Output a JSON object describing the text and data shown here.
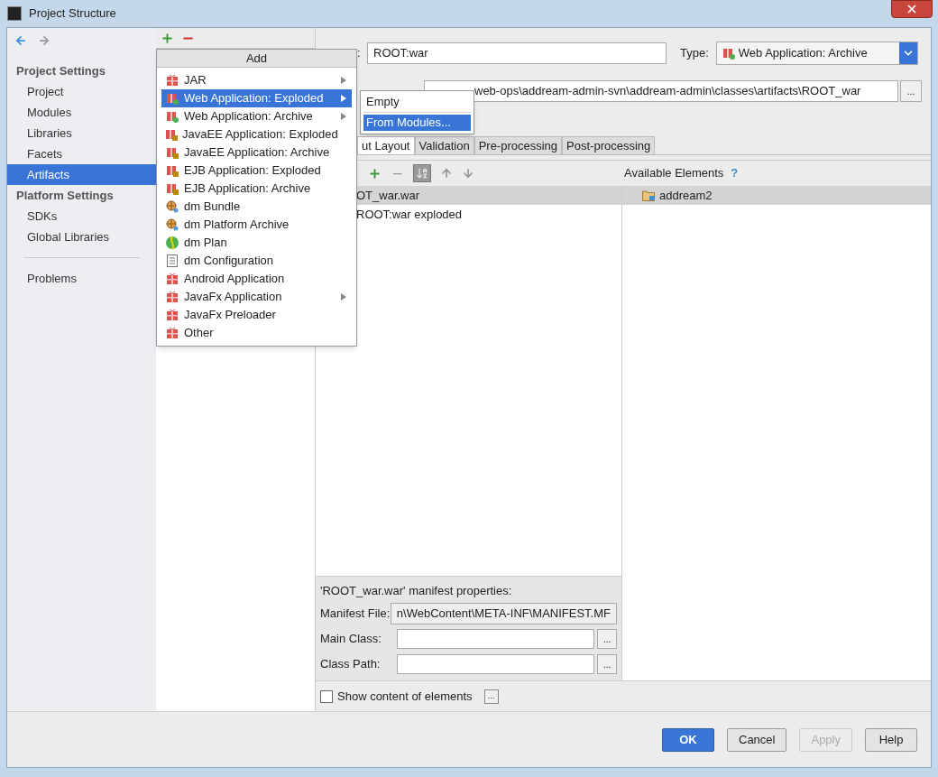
{
  "window": {
    "title": "Project Structure"
  },
  "nav": {
    "sections": [
      {
        "title": "Project Settings",
        "items": [
          {
            "label": "Project",
            "selected": false
          },
          {
            "label": "Modules",
            "selected": false
          },
          {
            "label": "Libraries",
            "selected": false
          },
          {
            "label": "Facets",
            "selected": false
          },
          {
            "label": "Artifacts",
            "selected": true
          }
        ]
      },
      {
        "title": "Platform Settings",
        "items": [
          {
            "label": "SDKs",
            "selected": false
          },
          {
            "label": "Global Libraries",
            "selected": false
          }
        ]
      }
    ],
    "extra": [
      {
        "label": "Problems",
        "selected": false
      }
    ]
  },
  "add_menu": {
    "title": "Add",
    "items": [
      {
        "label": "JAR",
        "kind": "artifact",
        "submenu": true,
        "selected": false
      },
      {
        "label": "Web Application: Exploded",
        "kind": "web",
        "submenu": true,
        "selected": true
      },
      {
        "label": "Web Application: Archive",
        "kind": "web",
        "submenu": true,
        "selected": false
      },
      {
        "label": "JavaEE Application: Exploded",
        "kind": "javaee",
        "submenu": false,
        "selected": false
      },
      {
        "label": "JavaEE Application: Archive",
        "kind": "javaee",
        "submenu": false,
        "selected": false
      },
      {
        "label": "EJB Application: Exploded",
        "kind": "javaee",
        "submenu": false,
        "selected": false
      },
      {
        "label": "EJB Application: Archive",
        "kind": "javaee",
        "submenu": false,
        "selected": false
      },
      {
        "label": "dm Bundle",
        "kind": "bundle",
        "submenu": false,
        "selected": false
      },
      {
        "label": "dm Platform Archive",
        "kind": "bundle",
        "submenu": false,
        "selected": false
      },
      {
        "label": "dm Plan",
        "kind": "plan",
        "submenu": false,
        "selected": false
      },
      {
        "label": "dm Configuration",
        "kind": "config",
        "submenu": false,
        "selected": false
      },
      {
        "label": "Android Application",
        "kind": "artifact",
        "submenu": false,
        "selected": false
      },
      {
        "label": "JavaFx Application",
        "kind": "artifact",
        "submenu": true,
        "selected": false
      },
      {
        "label": "JavaFx Preloader",
        "kind": "artifact",
        "submenu": false,
        "selected": false
      },
      {
        "label": "Other",
        "kind": "artifact",
        "submenu": false,
        "selected": false
      }
    ]
  },
  "submenu": {
    "items": [
      {
        "label": "Empty",
        "selected": false
      },
      {
        "label": "From Modules...",
        "selected": true
      }
    ]
  },
  "artifact": {
    "name_label": ":",
    "name_value": "ROOT:war",
    "type_label": "Type:",
    "type_value": "Web Application: Archive",
    "output_path": "web-ops\\addream-admin-svn\\addream-admin\\classes\\artifacts\\ROOT_war",
    "tabs": [
      {
        "label": "ut Layout",
        "selected": true
      },
      {
        "label": "Validation",
        "selected": false
      },
      {
        "label": "Pre-processing",
        "selected": false
      },
      {
        "label": "Post-processing",
        "selected": false
      }
    ],
    "tree": [
      {
        "label": "OT_war.war",
        "selected": true
      },
      {
        "label": "ROOT:war exploded",
        "selected": false
      }
    ],
    "available_title": "Available Elements",
    "help": "?",
    "available": [
      {
        "label": "addream2",
        "selected": true
      }
    ],
    "manifest": {
      "title": "'ROOT_war.war' manifest properties:",
      "fields": [
        {
          "label": "Manifest File:",
          "value": "n\\WebContent\\META-INF\\MANIFEST.MF",
          "kind": "readonly"
        },
        {
          "label": "Main Class:",
          "kind": "browse"
        },
        {
          "label": "Class Path:",
          "kind": "browse"
        }
      ]
    },
    "show_content": {
      "label": "Show content of elements",
      "checked": false
    },
    "browse": "..."
  },
  "buttons": [
    {
      "label": "OK",
      "kind": "primary"
    },
    {
      "label": "Cancel",
      "kind": "normal"
    },
    {
      "label": "Apply",
      "kind": "disabled"
    },
    {
      "label": "Help",
      "kind": "normal"
    }
  ]
}
